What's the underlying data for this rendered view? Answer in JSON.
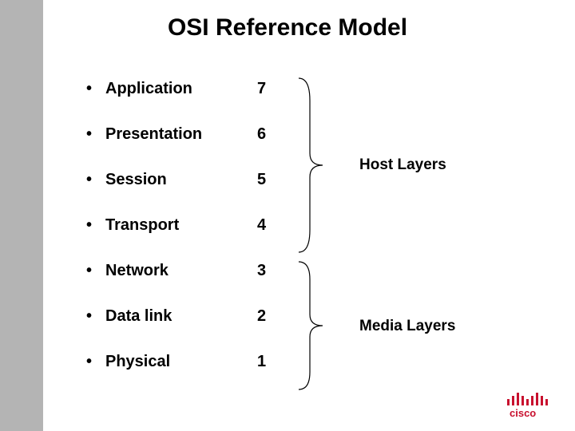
{
  "title": "OSI Reference Model",
  "layers": [
    {
      "name": "Application",
      "num": "7"
    },
    {
      "name": "Presentation",
      "num": "6"
    },
    {
      "name": "Session",
      "num": "5"
    },
    {
      "name": "Transport",
      "num": "4"
    },
    {
      "name": "Network",
      "num": "3"
    },
    {
      "name": "Data link",
      "num": "2"
    },
    {
      "name": "Physical",
      "num": "1"
    }
  ],
  "groups": {
    "host": "Host Layers",
    "media": "Media Layers"
  },
  "brand": {
    "name": "cisco",
    "color": "#c8102e"
  }
}
